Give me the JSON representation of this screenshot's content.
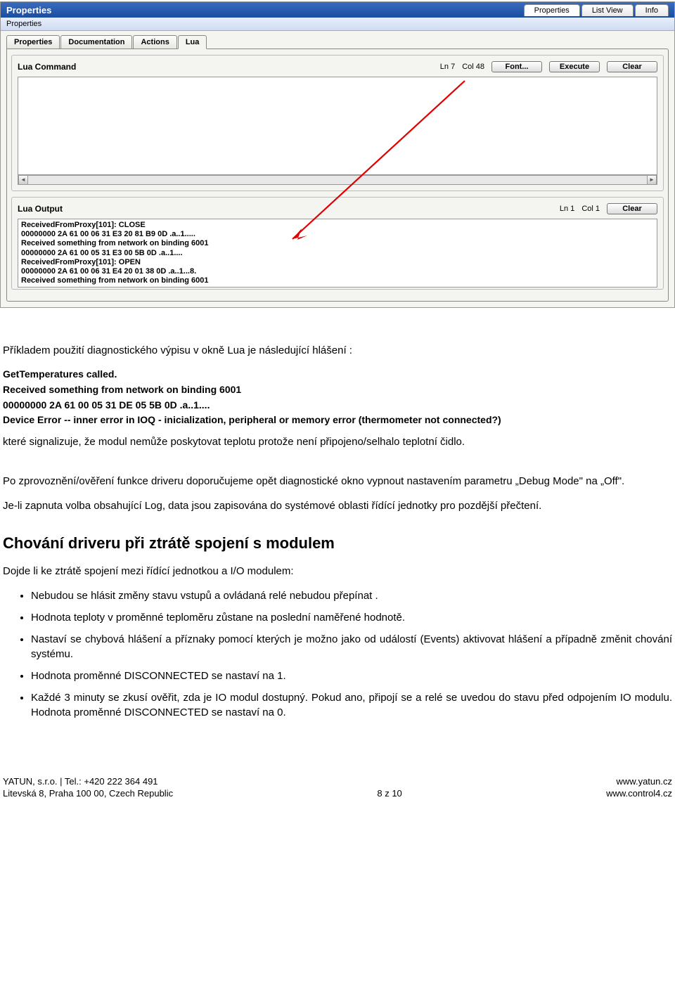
{
  "titlebar": {
    "title": "Properties",
    "tabs": [
      "Properties",
      "List View",
      "Info"
    ],
    "active": 0
  },
  "subheader": "Properties",
  "inner_tabs": [
    "Properties",
    "Documentation",
    "Actions",
    "Lua"
  ],
  "inner_active": 3,
  "lua_command": {
    "label": "Lua Command",
    "ln": "Ln 7",
    "col": "Col 48",
    "font_btn": "Font...",
    "execute_btn": "Execute",
    "clear_btn": "Clear"
  },
  "lua_output": {
    "label": "Lua Output",
    "ln": "Ln 1",
    "col": "Col 1",
    "clear_btn": "Clear",
    "lines": [
      "ReceivedFromProxy[101]: CLOSE",
      "00000000 2A 61 00 06 31 E3 20 81 B9 0D .a..1.....",
      "Received something from network on binding 6001",
      "00000000 2A 61 00 05 31 E3 00 5B 0D .a..1....",
      "ReceivedFromProxy[101]: OPEN",
      "00000000 2A 61 00 06 31 E4 20 01 38 0D .a..1...8.",
      "Received something from network on binding 6001"
    ]
  },
  "doc": {
    "intro": "Příkladem použití diagnostického výpisu v okně Lua je následující hlášení :",
    "mono": [
      "GetTemperatures called.",
      "Received something from network on binding 6001",
      "00000000 2A 61 00 05 31 DE 05 5B 0D .a..1....",
      "Device Error -- inner error in IOQ - inicialization, peripheral or memory error (thermometer not connected?)"
    ],
    "after_mono": "které signalizuje, že modul nemůže poskytovat teplotu protože není připojeno/selhalo teplotní čidlo.",
    "p1": "Po zprovoznění/ověření funkce driveru doporučujeme opět diagnostické okno vypnout nastavením parametru „Debug Mode\" na „Off\".",
    "p2": "Je-li zapnuta volba obsahující Log, data jsou zapisována do systémové oblasti řídící jednotky pro pozdější přečtení.",
    "heading": "Chování driveru při ztrátě spojení s modulem",
    "lead": "Dojde li ke ztrátě spojení mezi řídící jednotkou a I/O modulem:",
    "bullets": [
      "Nebudou se hlásit změny stavu vstupů a ovládaná relé nebudou přepínat .",
      "Hodnota teploty v proměnné teploměru zůstane na poslední naměřené hodnotě.",
      "Nastaví se chybová hlášení a příznaky pomocí kterých je možno jako od událostí (Events) aktivovat hlášení a případně změnit chování systému.",
      "Hodnota proměnné DISCONNECTED se nastaví na 1.",
      "Každé 3 minuty se zkusí ověřit, zda je IO modul dostupný. Pokud ano, připojí se a relé se uvedou do stavu před odpojením IO modulu. Hodnota proměnné DISCONNECTED se nastaví na 0."
    ]
  },
  "footer": {
    "left1": "YATUN, s.r.o. | Tel.: +420 222 364 491",
    "left2": "Litevská 8, Praha 100 00, Czech Republic",
    "center": "8 z 10",
    "right1": "www.yatun.cz",
    "right2": "www.control4.cz"
  }
}
